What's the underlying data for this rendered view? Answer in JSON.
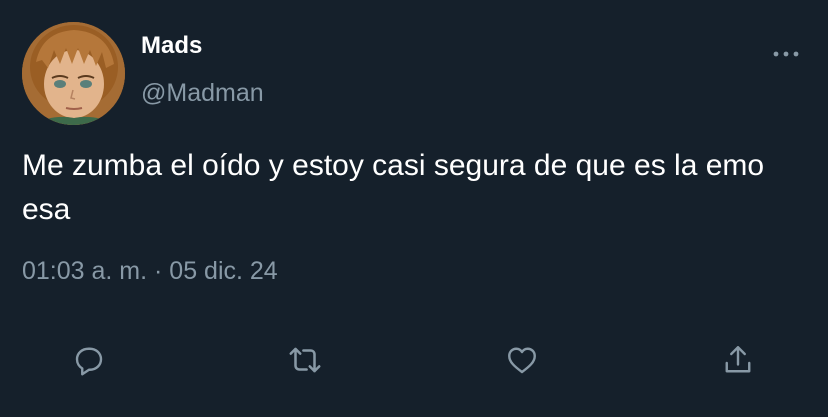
{
  "tweet": {
    "author": {
      "display_name": "Mads",
      "handle": "@Madman",
      "avatar_icon": "user-avatar"
    },
    "text": "Me zumba el oído y estoy casi segura de que es la emo esa",
    "timestamp": "01:03 a. m. · 05 dic. 24",
    "more_icon": "more-horizontal-icon"
  },
  "actions": [
    {
      "name": "reply",
      "icon": "reply-icon"
    },
    {
      "name": "retweet",
      "icon": "retweet-icon"
    },
    {
      "name": "like",
      "icon": "heart-icon"
    },
    {
      "name": "share",
      "icon": "share-icon"
    }
  ],
  "colors": {
    "background": "#15202b",
    "primary_text": "#ffffff",
    "secondary_text": "#8899a6"
  }
}
